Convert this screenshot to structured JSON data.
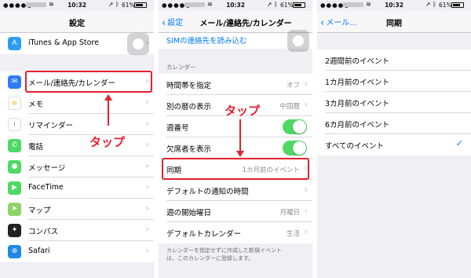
{
  "status": {
    "time": "10:32",
    "battery": "61%"
  },
  "p1": {
    "title": "設定",
    "items": [
      {
        "label": "iTunes & App Store"
      },
      {
        "label": "メール/連絡先/カレンダー"
      },
      {
        "label": "メモ"
      },
      {
        "label": "リマインダー"
      },
      {
        "label": "電話"
      },
      {
        "label": "メッセージ"
      },
      {
        "label": "FaceTime"
      },
      {
        "label": "マップ"
      },
      {
        "label": "コンパス"
      },
      {
        "label": "Safari"
      }
    ]
  },
  "p2": {
    "back": "設定",
    "title": "メール/連絡先/カレンダー",
    "sim": "SIMの連絡先を読み込む",
    "section": "カレンダー",
    "rows": [
      {
        "label": "時間帯を指定",
        "value": "オフ"
      },
      {
        "label": "別の暦の表示",
        "value": "中国暦"
      },
      {
        "label": "週番号",
        "value": ""
      },
      {
        "label": "欠席者を表示",
        "value": ""
      },
      {
        "label": "同期",
        "value": "1カ月前のイベント"
      },
      {
        "label": "デフォルトの通知の時間",
        "value": ""
      },
      {
        "label": "週の開始曜日",
        "value": "月曜日"
      },
      {
        "label": "デフォルトカレンダー",
        "value": "生活"
      }
    ],
    "footer_line1": "カレンダーを指定せずに作成した新規イベント",
    "footer_line2": "は、このカレンダーに登録します。"
  },
  "p3": {
    "back": "メール...",
    "title": "同期",
    "options": [
      {
        "label": "2週間前のイベント"
      },
      {
        "label": "1カ月前のイベント"
      },
      {
        "label": "3カ月前のイベント"
      },
      {
        "label": "6カ月前のイベント"
      },
      {
        "label": "すべてのイベント"
      }
    ],
    "selected_index": 4
  },
  "annotations": {
    "tap": "タップ"
  },
  "colors": {
    "ios_blue": "#007aff",
    "toggle_green": "#4cd964",
    "callout_red": "#e6202e"
  }
}
